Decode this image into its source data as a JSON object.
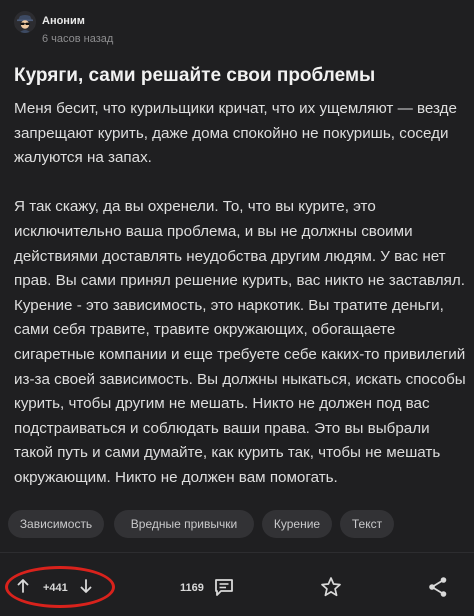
{
  "post": {
    "author": "Аноним",
    "time": "6 часов назад",
    "title": "Куряги, сами решайте свои проблемы",
    "paragraphs": [
      "Меня бесит, что курильщики кричат, что их ущемляют — везде запрещают курить, даже дома спокойно не покуришь, соседи жалуются на запах.",
      "Я так скажу, да вы охренели. То, что вы курите, это исключительно ваша проблема, и вы не должны своими действиями доставлять неудобства другим людям. У вас нет прав. Вы сами принял решение курить, вас никто не заставлял. Курение - это зависимость, это наркотик. Вы тратите деньги, сами себя травите, травите окружающих, обогащаете сигаретные компании и еще требуете себе каких-то привилегий из-за своей зависимость. Вы должны ныкаться, искать способы курить, чтобы другим не мешать. Никто не должен под вас подстраиваться и соблюдать ваши права. Это вы выбрали такой путь и сами думайте, как курить так, чтобы не мешать окружающим. Никто не должен вам помогать."
    ],
    "tags": [
      "Зависимость",
      "Вредные привычки",
      "Курение",
      "Текст"
    ]
  },
  "footer": {
    "score": "+441",
    "comments": "1169",
    "icons": [
      "upvote-arrow-icon",
      "downvote-arrow-icon",
      "comment-icon",
      "star-icon",
      "share-icon"
    ]
  },
  "colors": {
    "background": "#1f1f21",
    "tag_background": "#323235",
    "highlight_ring": "#d9221c"
  }
}
